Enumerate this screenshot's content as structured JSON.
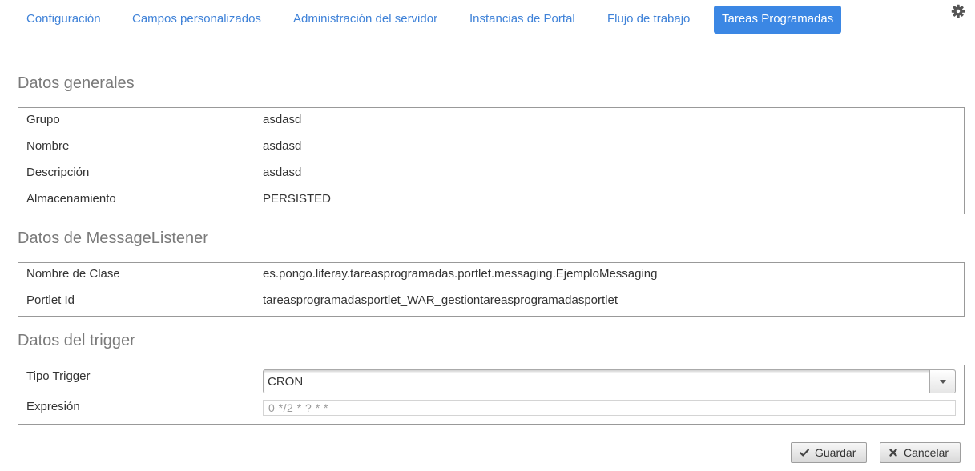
{
  "nav": {
    "tabs": [
      {
        "label": "Configuración",
        "active": false
      },
      {
        "label": "Campos personalizados",
        "active": false
      },
      {
        "label": "Administración del servidor",
        "active": false
      },
      {
        "label": "Instancias de Portal",
        "active": false
      },
      {
        "label": "Flujo de trabajo",
        "active": false
      },
      {
        "label": "Tareas Programadas",
        "active": true
      }
    ],
    "settings_icon": "gear-icon"
  },
  "general": {
    "title": "Datos generales",
    "rows": [
      {
        "label": "Grupo",
        "value": "asdasd"
      },
      {
        "label": "Nombre",
        "value": "asdasd"
      },
      {
        "label": "Descripción",
        "value": "asdasd"
      },
      {
        "label": "Almacenamiento",
        "value": "PERSISTED"
      }
    ]
  },
  "listener": {
    "title": "Datos de MessageListener",
    "rows": [
      {
        "label": "Nombre de Clase",
        "value": "es.pongo.liferay.tareasprogramadas.portlet.messaging.EjemploMessaging"
      },
      {
        "label": "Portlet Id",
        "value": "tareasprogramadasportlet_WAR_gestiontareasprogramadasportlet"
      }
    ]
  },
  "trigger": {
    "title": "Datos del trigger",
    "type_label": "Tipo Trigger",
    "type_value": "CRON",
    "expression_label": "Expresión",
    "expression_value": "",
    "expression_placeholder": "0 */2 * ? * *"
  },
  "actions": {
    "save_label": "Guardar",
    "save_icon": "check-icon",
    "cancel_label": "Cancelar",
    "cancel_icon": "close-icon"
  },
  "colors": {
    "accent": "#3b87e4",
    "link": "#3f82d8",
    "section_title": "#7a7a7a",
    "border": "#999999"
  }
}
